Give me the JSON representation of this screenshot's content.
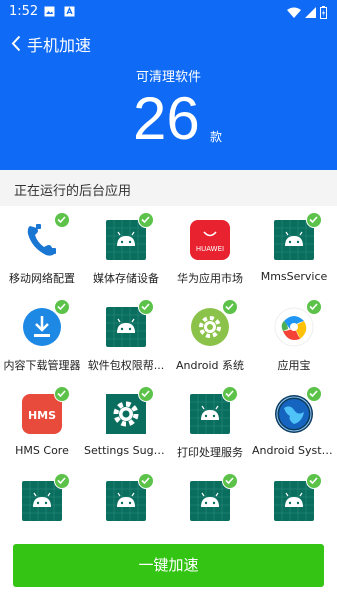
{
  "status_bar": {
    "time": "1:52"
  },
  "header": {
    "title": "手机加速",
    "clean_label": "可清理软件",
    "count": "26",
    "count_unit": "款"
  },
  "section": {
    "title": "正在运行的后台应用"
  },
  "apps": [
    {
      "label": "移动网络配置",
      "icon": "phone-icon"
    },
    {
      "label": "媒体存储设备",
      "icon": "android-icon"
    },
    {
      "label": "华为应用市场",
      "icon": "huawei-appgallery-icon",
      "icon_text": "HUAWEI"
    },
    {
      "label": "MmsService",
      "icon": "android-icon"
    },
    {
      "label": "内容下载管理器",
      "icon": "download-manager-icon"
    },
    {
      "label": "软件包权限帮...",
      "icon": "android-icon"
    },
    {
      "label": "Android 系统",
      "icon": "android-settings-gear-icon"
    },
    {
      "label": "应用宝",
      "icon": "yingyongbao-icon"
    },
    {
      "label": "HMS Core",
      "icon": "hms-core-icon",
      "icon_text": "HMS"
    },
    {
      "label": "Settings Sugge...",
      "icon": "settings-gear-icon"
    },
    {
      "label": "打印处理服务",
      "icon": "android-icon"
    },
    {
      "label": "Android Syste...",
      "icon": "globe-icon"
    },
    {
      "label": "",
      "icon": "android-icon"
    },
    {
      "label": "",
      "icon": "android-icon"
    },
    {
      "label": "",
      "icon": "android-icon"
    },
    {
      "label": "",
      "icon": "android-icon"
    }
  ],
  "action_button": {
    "label": "一键加速"
  },
  "colors": {
    "header_blue": "#0f6af5",
    "check_green": "#5cc24a",
    "button_green": "#33c414",
    "tile_teal": "#0a6e5f"
  }
}
